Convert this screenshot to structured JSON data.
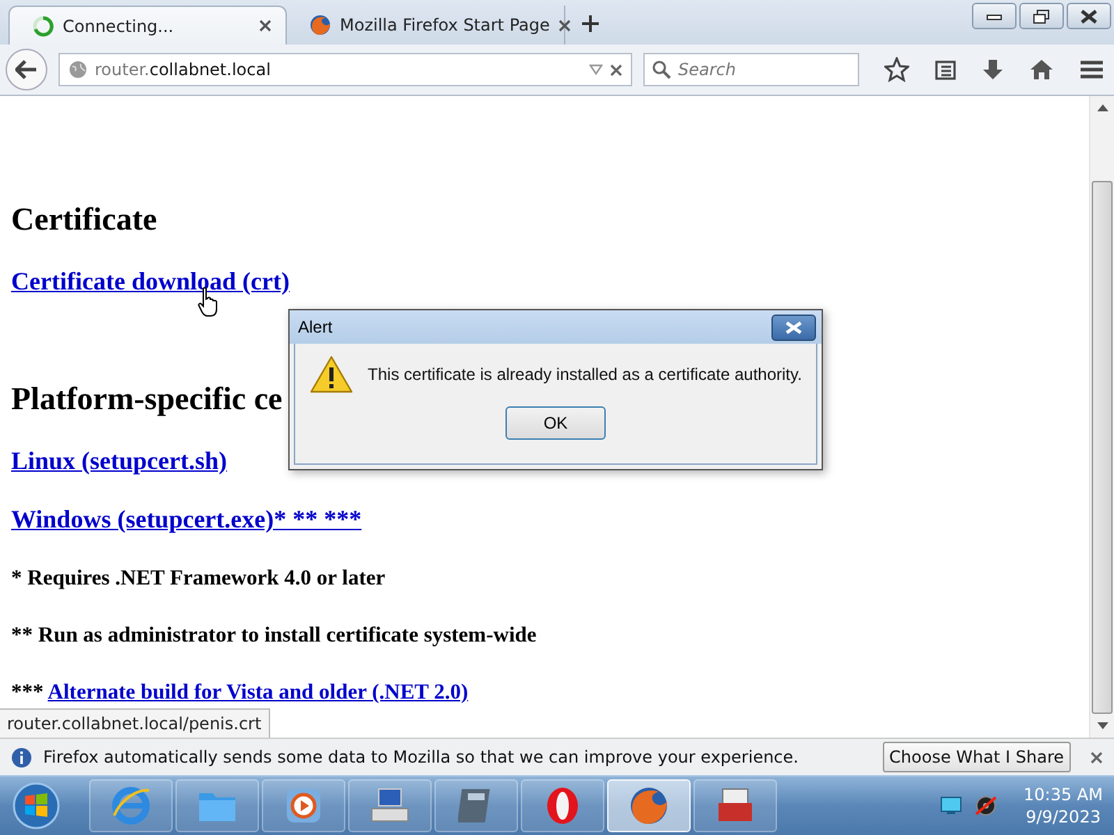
{
  "tabs": [
    {
      "label": "Connecting...",
      "kind": "loading",
      "selected": true
    },
    {
      "label": "Mozilla Firefox Start Page",
      "kind": "page",
      "selected": false
    }
  ],
  "address": {
    "subdomain": "router.",
    "domain": "collabnet.local"
  },
  "search": {
    "placeholder": "Search"
  },
  "page": [
    {
      "kind": "heading",
      "text": "Certificate"
    },
    {
      "kind": "link",
      "text": "Certificate download (crt)"
    },
    {
      "kind": "heading",
      "text": "Platform-specific ce"
    },
    {
      "kind": "link",
      "text": "Linux (setupcert.sh)"
    },
    {
      "kind": "link",
      "text": "Windows (setupcert.exe)* ** ***"
    },
    {
      "kind": "note",
      "text": "* Requires .NET Framework 4.0 or later"
    },
    {
      "kind": "note",
      "text": "** Run as administrator to install certificate system-wide"
    },
    {
      "kind": "note",
      "text": "*** ",
      "link": "Alternate build for Vista and older (.NET 2.0)"
    }
  ],
  "link_preview": "router.collabnet.local/penis.crt",
  "alert": {
    "title": "Alert",
    "message": "This certificate is already installed as a certificate authority.",
    "button": "OK"
  },
  "notification": {
    "message": "Firefox automatically sends some data to Mozilla so that we can improve your experience.",
    "button": "Choose What I Share"
  },
  "taskbar": {
    "buttons": [
      {
        "selected": false
      },
      {
        "selected": false
      },
      {
        "selected": false
      },
      {
        "selected": false
      },
      {
        "selected": false
      },
      {
        "selected": false
      },
      {
        "selected": true
      },
      {
        "selected": false
      }
    ],
    "time": "10:35 AM",
    "date": "9/9/2023"
  }
}
